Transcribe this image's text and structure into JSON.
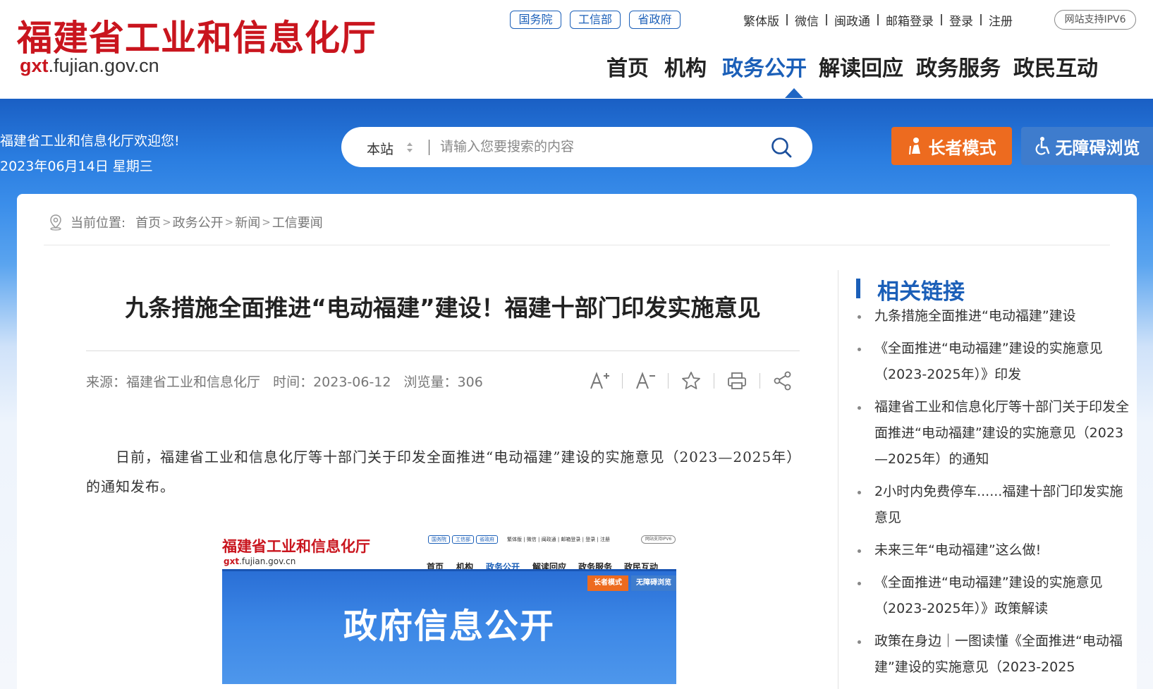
{
  "header": {
    "logo_cn": "福建省工业和信息化厅",
    "logo_en_prefix": "gxt",
    "logo_en_suffix": ".fujian.gov.cn",
    "top_tags": [
      "国务院",
      "工信部",
      "省政府"
    ],
    "top_links": [
      "繁体版",
      "微信",
      "闽政通",
      "邮箱登录",
      "登录",
      "注册"
    ],
    "ipv6_badge": "网站支持IPV6",
    "nav": [
      "首页",
      "机构",
      "政务公开",
      "解读回应",
      "政务服务",
      "政民互动"
    ],
    "nav_active": "政务公开"
  },
  "banner": {
    "welcome": "福建省工业和信息化厅欢迎您!",
    "date": "2023年06月14日 星期三",
    "search_scope": "本站",
    "search_placeholder": "请输入您要搜索的内容",
    "elder_mode": "长者模式",
    "accessible_browse": "无障碍浏览"
  },
  "breadcrumb": {
    "label": "当前位置:",
    "items": [
      "首页",
      "政务公开",
      "新闻",
      "工信要闻"
    ]
  },
  "article": {
    "title": "九条措施全面推进“电动福建”建设！福建十部门印发实施意见",
    "source": "来源：福建省工业和信息化厅",
    "time": "时间：2023-06-12",
    "views": "浏览量：306",
    "tools": [
      "font-increase-icon",
      "font-decrease-icon",
      "star-icon",
      "print-icon",
      "share-icon"
    ],
    "paragraph": "日前，福建省工业和信息化厅等十部门关于印发全面推进“电动福建”建设的实施意见（2023—2025年）的通知发布。"
  },
  "embedded_screenshot": {
    "logo_cn": "福建省工业和信息化厅",
    "logo_en_prefix": "gxt",
    "logo_en_suffix": ".fujian.gov.cn",
    "tags": [
      "国务院",
      "工信部",
      "省政府"
    ],
    "links": "繁体版 | 微信 | 闽政通 | 邮箱登录 | 登录 | 注册",
    "ipv6": "网站支持IPV6",
    "nav": [
      "首页",
      "机构",
      "政务公开",
      "解读回应",
      "政务服务",
      "政民互动"
    ],
    "elder_mode": "长者模式",
    "accessible_browse": "无障碍浏览",
    "banner_title": "政府信息公开"
  },
  "sidebar": {
    "title": "相关链接",
    "links": [
      "九条措施全面推进“电动福建”建设",
      "《全面推进“电动福建”建设的实施意见（2023-2025年）》印发",
      "福建省工业和信息化厅等十部门关于印发全面推进“电动福建”建设的实施意见（2023—2025年）的通知",
      "2小时内免费停车......福建十部门印发实施意见",
      "未来三年“电动福建”这么做!",
      "《全面推进“电动福建”建设的实施意见（2023-2025年）》政策解读",
      "政策在身边｜一图读懂《全面推进“电动福建”建设的实施意见（2023-2025"
    ]
  },
  "colors": {
    "brand_red": "#c9151e",
    "brand_blue": "#1b5fb8",
    "elder_orange": "#ed6b1f"
  }
}
